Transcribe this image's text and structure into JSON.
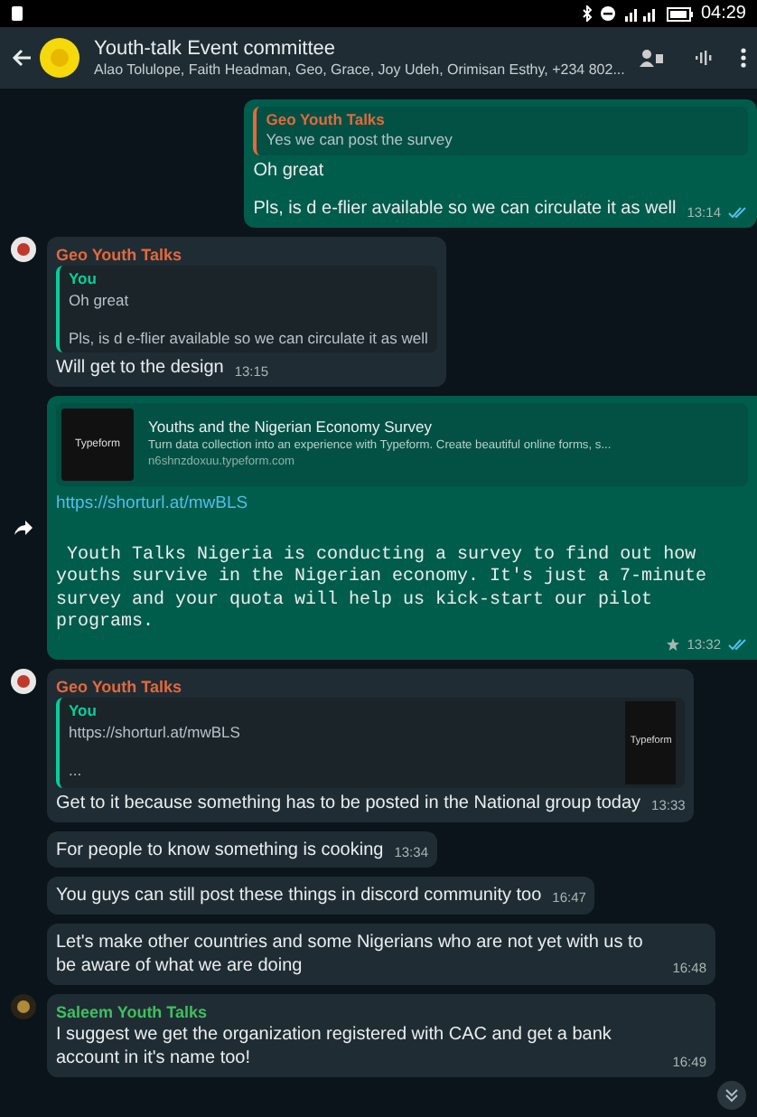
{
  "status_bar": {
    "time": "04:29"
  },
  "header": {
    "title": "Youth-talk Event committee",
    "subtitle": "Alao Tolulope, Faith Headman, Geo, Grace, Joy Udeh, Orimisan Esthy, +234 802..."
  },
  "messages": [
    {
      "kind": "out",
      "quote": {
        "author": "Geo Youth Talks",
        "color": "#e5683b",
        "lines": [
          "Yes we can post the survey"
        ]
      },
      "paragraphs": [
        "Oh great",
        "Pls, is d e-flier available so we can circulate it as well"
      ],
      "time": "13:14",
      "read": true,
      "starred": false
    },
    {
      "kind": "in",
      "sender": {
        "name": "Geo Youth Talks",
        "color": "#e5683b"
      },
      "quote": {
        "author": "You",
        "color": "#06cf9c",
        "lines": [
          "Oh great",
          "Pls, is d e-flier available so we can circulate it as well"
        ]
      },
      "paragraphs": [
        "Will get to the design"
      ],
      "time": "13:15"
    },
    {
      "kind": "out",
      "forwarded": true,
      "preview": {
        "thumbnail": "Typeform",
        "title": "Youths and the Nigerian Economy Survey",
        "description": "Turn data collection into an experience with Typeform. Create beautiful online forms, s...",
        "domain": "n6shnzdoxuu.typeform.com"
      },
      "link": "https://shorturl.at/mwBLS",
      "paragraphs": [
        " Youth Talks Nigeria is conducting a survey to find out how youths survive in the Nigerian economy. It's just a 7-minute survey and your quota will help us kick-start our pilot programs."
      ],
      "monospace": true,
      "time": "13:32",
      "read": true,
      "starred": true
    },
    {
      "kind": "in",
      "sender": {
        "name": "Geo Youth Talks",
        "color": "#e5683b"
      },
      "quote": {
        "author": "You",
        "color": "#06cf9c",
        "lines": [
          "https://shorturl.at/mwBLS",
          "..."
        ],
        "thumbnail": "Typeform"
      },
      "paragraphs": [
        "Get to it because something has to be posted in the National group today"
      ],
      "time": "13:33"
    },
    {
      "kind": "in",
      "paragraphs": [
        "For people to know something is cooking"
      ],
      "time": "13:34"
    },
    {
      "kind": "in",
      "paragraphs": [
        "You guys can still post these things in discord community too"
      ],
      "time": "16:47"
    },
    {
      "kind": "in",
      "paragraphs": [
        "Let's make other countries and some Nigerians who are not yet with us to be aware of what we are doing"
      ],
      "time": "16:48"
    },
    {
      "kind": "in",
      "sender": {
        "name": "Saleem Youth Talks",
        "color": "#3fbf5f"
      },
      "paragraphs": [
        "I suggest we get the organization registered with CAC and get a bank account in it's name too!"
      ],
      "time": "16:49"
    }
  ]
}
